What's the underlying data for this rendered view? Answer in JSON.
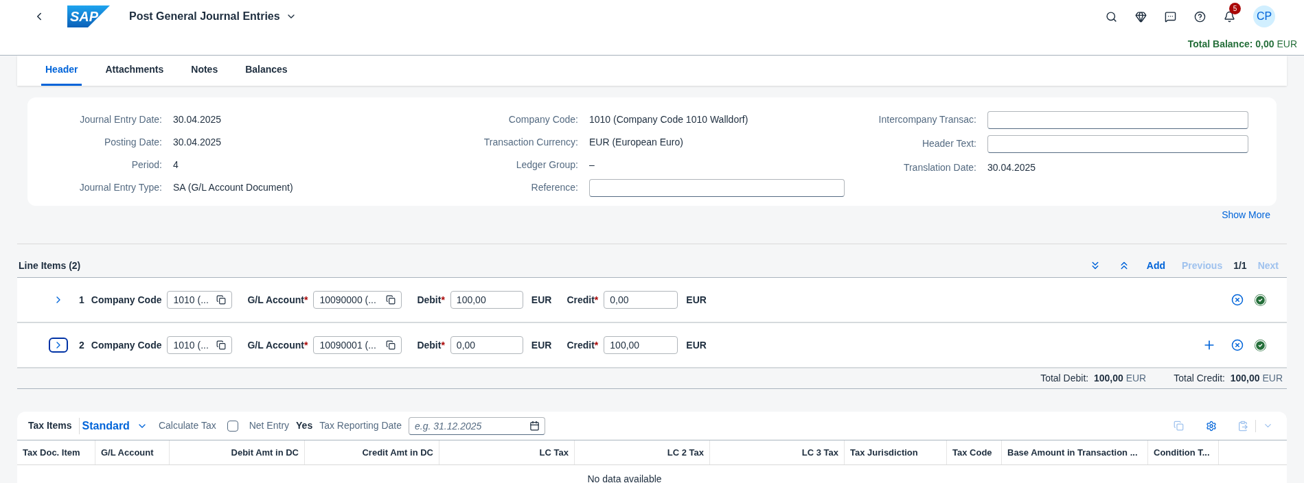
{
  "shell": {
    "logo_text": "SAP",
    "title": "Post General Journal Entries",
    "notifications": "5",
    "avatar": "CP",
    "total_balance": {
      "label": "Total Balance:",
      "value": "0,00",
      "currency": "EUR"
    }
  },
  "tabs": [
    {
      "label": "Header",
      "selected": true
    },
    {
      "label": "Attachments",
      "selected": false
    },
    {
      "label": "Notes",
      "selected": false
    },
    {
      "label": "Balances",
      "selected": false
    }
  ],
  "header_fields": [
    [
      {
        "label": "Journal Entry Date:",
        "kind": "text",
        "value": "30.04.2025"
      },
      {
        "label": "Posting Date:",
        "kind": "text",
        "value": "30.04.2025"
      },
      {
        "label": "Period:",
        "kind": "text",
        "value": "4"
      },
      {
        "label": "Journal Entry Type:",
        "kind": "text",
        "value": "SA (G/L Account Document)"
      }
    ],
    [
      {
        "label": "Company Code:",
        "kind": "text",
        "value": "1010 (Company Code 1010 Walldorf)"
      },
      {
        "label": "Transaction Currency:",
        "kind": "text",
        "value": "EUR (European Euro)"
      },
      {
        "label": "Ledger Group:",
        "kind": "text",
        "value": "–"
      },
      {
        "label": "Reference:",
        "kind": "input"
      }
    ],
    [
      {
        "label": "Intercompany Transac:",
        "kind": "input"
      },
      {
        "label": "Header Text:",
        "kind": "input"
      },
      {
        "label": "Translation Date:",
        "kind": "text",
        "value": "30.04.2025"
      }
    ]
  ],
  "show_more": "Show More",
  "line_items": {
    "title": "Line Items (2)",
    "add": "Add",
    "previous": {
      "label": "Previous",
      "disabled": true
    },
    "page": "1/1",
    "next": {
      "label": "Next",
      "disabled": true
    },
    "rows": [
      {
        "number": "1",
        "focused": false,
        "can_add": false,
        "valid": true,
        "fields": [
          {
            "label": "Company Code",
            "value": "1010 (...",
            "value_help": true
          },
          {
            "label": "G/L Account",
            "required_mark": "*",
            "value": "10090000 (...",
            "value_help": true
          },
          {
            "label": "Debit",
            "required_mark": "*",
            "value": "100,00",
            "value_help": false,
            "currency": "EUR"
          },
          {
            "label": "Credit",
            "required_mark": "*",
            "value": "0,00",
            "value_help": false,
            "currency": "EUR"
          }
        ]
      },
      {
        "number": "2",
        "focused": true,
        "can_add": true,
        "valid": true,
        "fields": [
          {
            "label": "Company Code",
            "value": "1010 (...",
            "value_help": true
          },
          {
            "label": "G/L Account",
            "required_mark": "*",
            "value": "10090001 (...",
            "value_help": true
          },
          {
            "label": "Debit",
            "required_mark": "*",
            "value": "0,00",
            "value_help": false,
            "currency": "EUR"
          },
          {
            "label": "Credit",
            "required_mark": "*",
            "value": "100,00",
            "value_help": false,
            "currency": "EUR"
          }
        ]
      }
    ],
    "totals": [
      {
        "label": "Total Debit:",
        "value": "100,00",
        "currency": "EUR"
      },
      {
        "label": "Total Credit:",
        "value": "100,00",
        "currency": "EUR"
      }
    ]
  },
  "tax_items": {
    "title": "Tax Items",
    "variant": "Standard",
    "calculate_tax": {
      "label": "Calculate Tax",
      "checked": false
    },
    "net_entry": {
      "label": "Net Entry",
      "value": "Yes"
    },
    "reporting_date": {
      "label": "Tax Reporting Date",
      "placeholder": "e.g. 31.12.2025"
    },
    "columns": [
      "Tax Doc. Item",
      "G/L Account",
      "Debit Amt in DC",
      "Credit Amt in DC",
      "LC Tax",
      "LC 2 Tax",
      "LC 3 Tax",
      "Tax Jurisdiction",
      "Tax Code",
      "Base Amount in Transaction ...",
      "Condition T..."
    ],
    "empty_text": "No data available"
  }
}
